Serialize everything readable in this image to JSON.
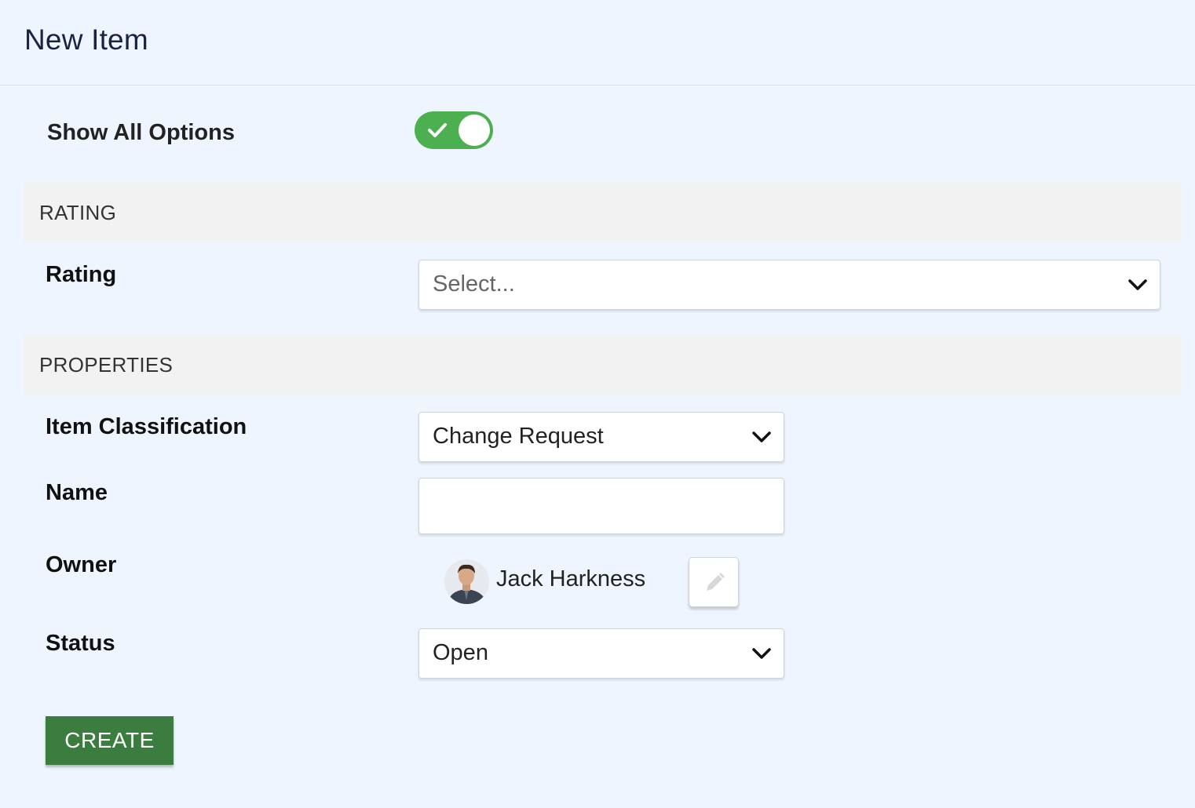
{
  "page": {
    "title": "New Item"
  },
  "options": {
    "show_all_label": "Show All Options",
    "show_all_enabled": true,
    "toggle_color": "#4caf50"
  },
  "sections": {
    "rating": {
      "header": "RATING",
      "rating_label": "Rating",
      "rating_placeholder": "Select..."
    },
    "properties": {
      "header": "PROPERTIES",
      "classification_label": "Item Classification",
      "classification_value": "Change Request",
      "name_label": "Name",
      "name_value": "",
      "owner_label": "Owner",
      "owner_name": "Jack Harkness",
      "status_label": "Status",
      "status_value": "Open"
    }
  },
  "actions": {
    "create_label": "CREATE",
    "create_color": "#3a7d3e"
  },
  "icons": {
    "toggle": "check-icon",
    "select": "chevron-down-icon",
    "edit": "pencil-icon",
    "owner": "avatar"
  }
}
